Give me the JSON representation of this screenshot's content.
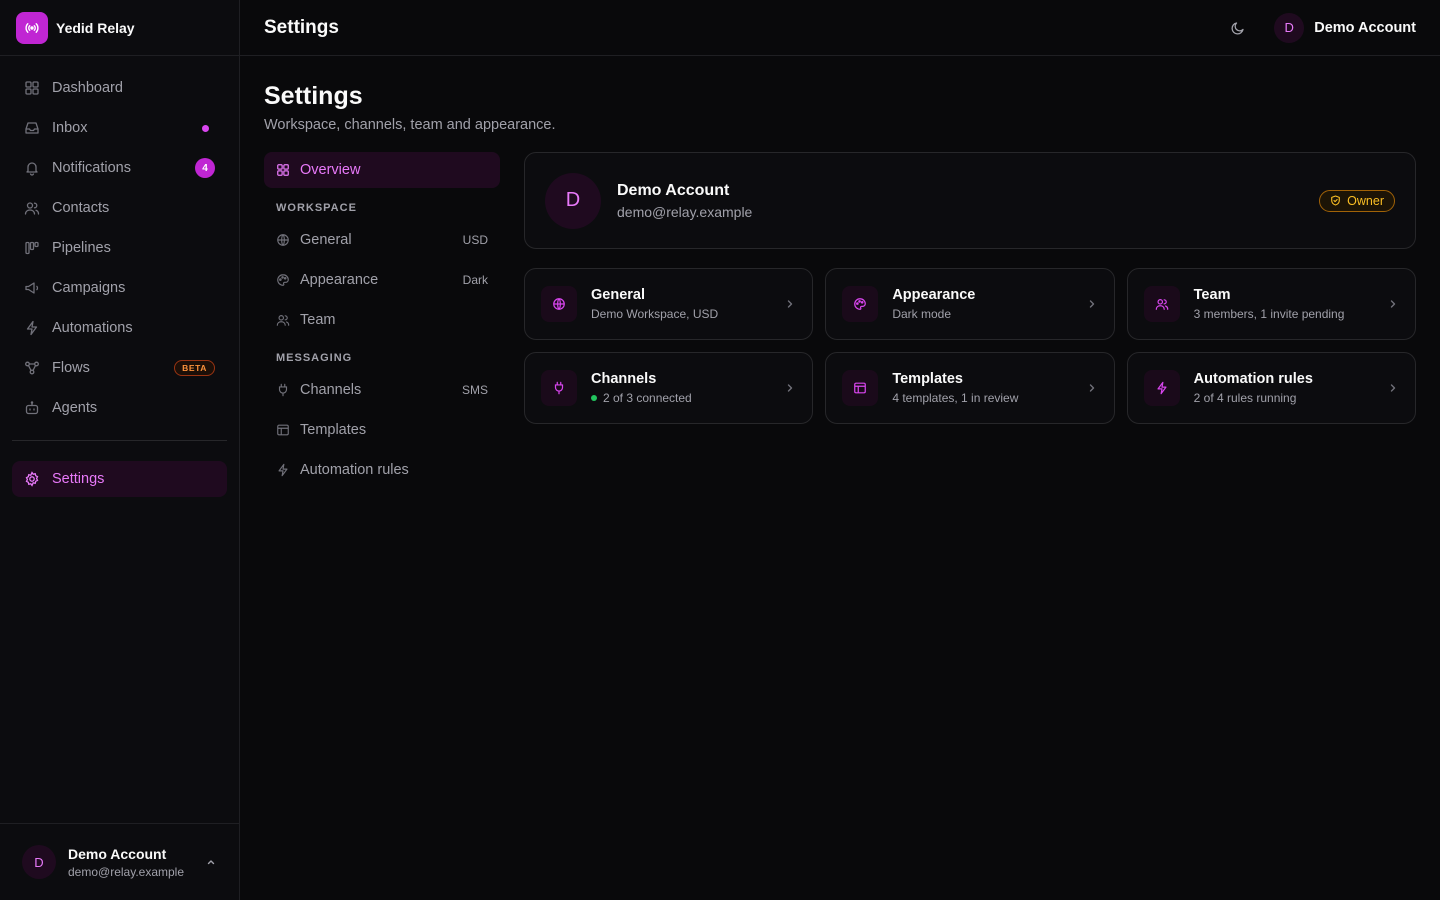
{
  "brand": {
    "name": "Yedid Relay",
    "logo_icon": "broadcast-icon",
    "accent": "#c026d3"
  },
  "sidebar": {
    "items": [
      {
        "label": "Dashboard",
        "icon": "dashboard-icon"
      },
      {
        "label": "Inbox",
        "icon": "inbox-icon",
        "indicator": "dot"
      },
      {
        "label": "Notifications",
        "icon": "bell-icon",
        "count": "4"
      },
      {
        "label": "Contacts",
        "icon": "users-icon"
      },
      {
        "label": "Pipelines",
        "icon": "pipeline-icon"
      },
      {
        "label": "Campaigns",
        "icon": "megaphone-icon"
      },
      {
        "label": "Automations",
        "icon": "bolt-icon"
      },
      {
        "label": "Flows",
        "icon": "flows-icon",
        "badge": "BETA"
      },
      {
        "label": "Agents",
        "icon": "bot-icon"
      }
    ],
    "settings": {
      "label": "Settings",
      "icon": "gear-icon",
      "active": true
    },
    "user": {
      "initial": "D",
      "name": "Demo Account",
      "email": "demo@relay.example"
    }
  },
  "topbar": {
    "title": "Settings",
    "theme_icon": "moon-icon",
    "user": {
      "initial": "D",
      "name": "Demo Account"
    }
  },
  "page": {
    "title": "Settings",
    "subtitle": "Workspace, channels, team and appearance."
  },
  "settings_nav": {
    "overview": {
      "label": "Overview",
      "icon": "dashboard-icon",
      "active": true
    },
    "workspace_heading": "WORKSPACE",
    "workspace": [
      {
        "label": "General",
        "icon": "globe-icon",
        "meta": "USD"
      },
      {
        "label": "Appearance",
        "icon": "palette-icon",
        "meta": "Dark"
      },
      {
        "label": "Team",
        "icon": "users-icon",
        "meta": ""
      }
    ],
    "messaging_heading": "MESSAGING",
    "messaging": [
      {
        "label": "Channels",
        "icon": "plug-icon",
        "meta": "SMS"
      },
      {
        "label": "Templates",
        "icon": "template-icon",
        "meta": ""
      },
      {
        "label": "Automation rules",
        "icon": "bolt-icon",
        "meta": ""
      }
    ]
  },
  "profile": {
    "initial": "D",
    "name": "Demo Account",
    "email": "demo@relay.example",
    "role": "Owner",
    "role_icon": "shield-icon",
    "role_color": "#fbbf24"
  },
  "cards": [
    {
      "title": "General",
      "subtitle": "Demo Workspace, USD",
      "icon": "globe-icon"
    },
    {
      "title": "Appearance",
      "subtitle": "Dark mode",
      "icon": "palette-icon"
    },
    {
      "title": "Team",
      "subtitle": "3 members, 1 invite pending",
      "icon": "users-icon"
    },
    {
      "title": "Channels",
      "subtitle": "2 of 3 connected",
      "icon": "plug-icon",
      "status_color": "#22c55e"
    },
    {
      "title": "Templates",
      "subtitle": "4 templates, 1 in review",
      "icon": "template-icon"
    },
    {
      "title": "Automation rules",
      "subtitle": "2 of 4 rules running",
      "icon": "bolt-icon"
    }
  ]
}
